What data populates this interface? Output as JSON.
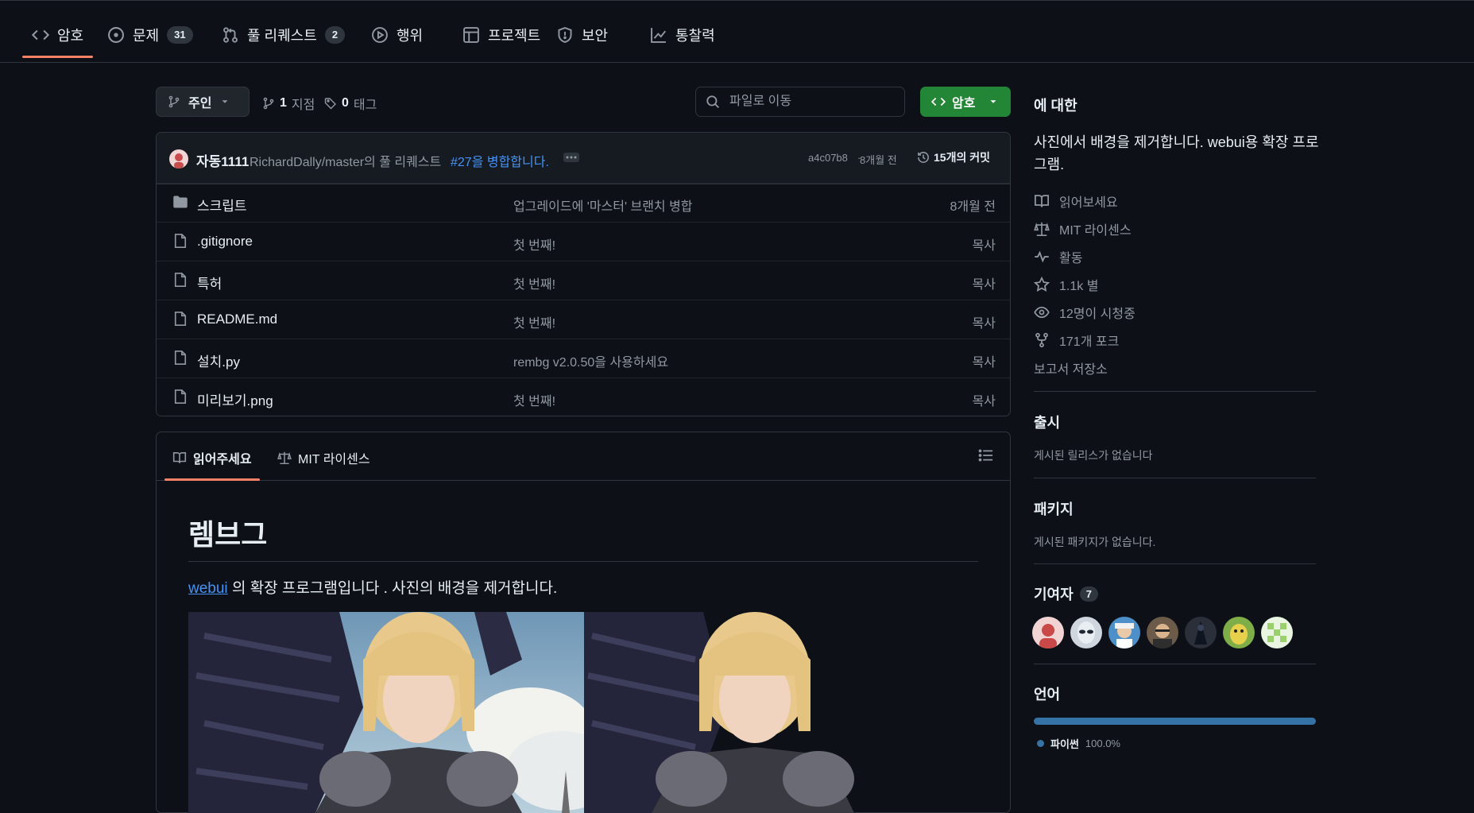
{
  "tabs": [
    {
      "label": "암호",
      "icon": "code-icon"
    },
    {
      "label": "문제",
      "count": "31",
      "icon": "issue-icon"
    },
    {
      "label": "풀 리퀘스트",
      "count": "2",
      "icon": "pull-request-icon"
    },
    {
      "label": "행위",
      "icon": "play-icon"
    },
    {
      "label": "프로젝트",
      "icon": "table-icon"
    },
    {
      "label": "보안",
      "icon": "shield-icon"
    },
    {
      "label": "통찰력",
      "icon": "graph-icon"
    }
  ],
  "repo_bar": {
    "branch": "주인",
    "branches_count": "1",
    "branches_label": "지점",
    "tags_count": "0",
    "tags_label": "태그",
    "search_placeholder": "파일로 이동",
    "code_button": "암호"
  },
  "commit": {
    "author": "자동1111",
    "message_prefix": "RichardDally/master의 풀 리퀘스트",
    "message_link": "#27을 병합합니다.",
    "hash": "a4c07b8",
    "age": "8개월 전",
    "commit_count": "15개의 커밋"
  },
  "files": [
    {
      "name": "스크립트",
      "type": "folder",
      "message": "업그레이드에 '마스터' 브랜치 병합",
      "age": "8개월 전"
    },
    {
      "name": ".gitignore",
      "type": "file",
      "message": "첫 번째!",
      "age": "목사"
    },
    {
      "name": "특허",
      "type": "file",
      "message": "첫 번째!",
      "age": "목사"
    },
    {
      "name": "README.md",
      "type": "file",
      "message": "첫 번째!",
      "age": "목사"
    },
    {
      "name": "설치.py",
      "type": "file",
      "message": "rembg v2.0.50을 사용하세요",
      "age": "목사"
    },
    {
      "name": "미리보기.png",
      "type": "file",
      "message": "첫 번째!",
      "age": "목사"
    }
  ],
  "readme": {
    "tab_readme": "읽어주세요",
    "tab_license": "MIT 라이센스",
    "heading": "렘브그",
    "intro_link": "webui",
    "intro_text": "의 확장 프로그램입니다 . 사진의 배경을 제거합니다."
  },
  "sidebar": {
    "about_title": "에 대한",
    "description": "사진에서 배경을 제거합니다. webui용 확장 프로그램.",
    "links": [
      {
        "label": "읽어보세요",
        "icon": "book-icon"
      },
      {
        "label": "MIT 라이센스",
        "icon": "law-icon"
      },
      {
        "label": "활동",
        "icon": "pulse-icon"
      },
      {
        "label": "1.1k 별",
        "icon": "star-icon"
      },
      {
        "label": "12명이 시청중",
        "icon": "eye-icon"
      },
      {
        "label": "171개 포크",
        "icon": "fork-icon"
      }
    ],
    "report": "보고서 저장소",
    "releases_title": "출시",
    "releases_text": "게시된 릴리스가 없습니다",
    "packages_title": "패키지",
    "packages_text": "게시된 패키지가 없습니다.",
    "contributors_title": "기여자",
    "contributors_count": "7",
    "languages_title": "언어",
    "language_name": "파이썬",
    "language_percent": "100.0%",
    "language_color": "#3572A5"
  },
  "colors": {
    "accent_green": "#238636",
    "tab_underline": "#f78166",
    "link": "#4493f8"
  }
}
